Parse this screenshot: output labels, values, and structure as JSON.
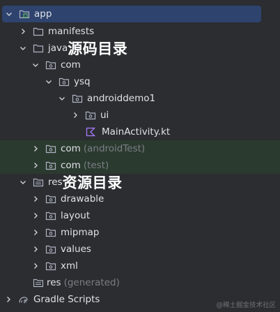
{
  "colors": {
    "background": "#2b2d30",
    "selection": "#2e436e",
    "tinted_row": "#2b3a2f",
    "text": "#dfe1e5",
    "muted_text": "#7a7e85",
    "folder_stroke": "#aeb3c2",
    "module_accent": "#5fb865",
    "kotlin_accent": "#a97bff"
  },
  "tree": {
    "app": {
      "label": "app",
      "icon": "module-folder-icon"
    },
    "manifests": {
      "label": "manifests",
      "icon": "folder-icon"
    },
    "java": {
      "label": "java",
      "annotation": "源码目录",
      "icon": "source-folder-icon"
    },
    "com": {
      "label": "com",
      "icon": "package-icon"
    },
    "ysq": {
      "label": "ysq",
      "icon": "package-icon"
    },
    "androiddemo1": {
      "label": "androiddemo1",
      "icon": "package-icon"
    },
    "ui": {
      "label": "ui",
      "icon": "package-icon"
    },
    "mainactivity": {
      "label": "MainActivity.kt",
      "icon": "kotlin-file-icon"
    },
    "com_androidtest": {
      "label": "com",
      "suffix": "(androidTest)",
      "icon": "package-icon"
    },
    "com_test": {
      "label": "com",
      "suffix": "(test)",
      "icon": "package-icon"
    },
    "res": {
      "label": "res",
      "annotation": "资源目录",
      "icon": "resource-folder-icon"
    },
    "drawable": {
      "label": "drawable",
      "icon": "package-icon"
    },
    "layout": {
      "label": "layout",
      "icon": "package-icon"
    },
    "mipmap": {
      "label": "mipmap",
      "icon": "package-icon"
    },
    "values": {
      "label": "values",
      "icon": "package-icon"
    },
    "xml": {
      "label": "xml",
      "icon": "package-icon"
    },
    "res_generated": {
      "label": "res",
      "suffix": "(generated)",
      "icon": "resource-folder-icon"
    },
    "gradle_scripts": {
      "label": "Gradle Scripts",
      "icon": "gradle-icon"
    }
  },
  "watermark": "@稀土掘金技术社区"
}
